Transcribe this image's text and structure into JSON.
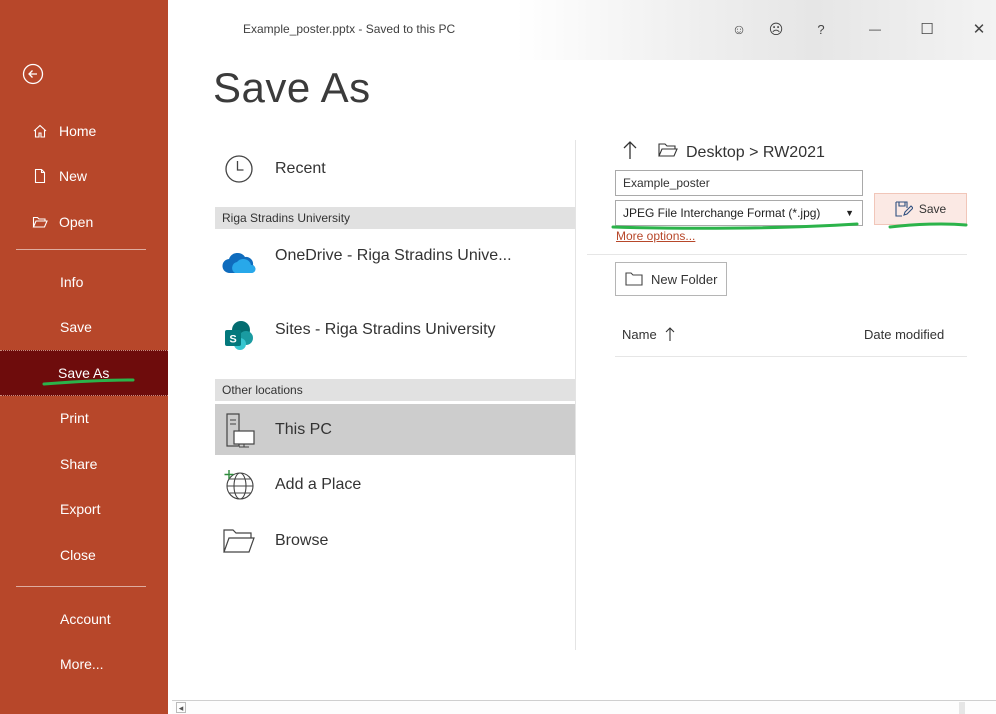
{
  "window": {
    "title": "Example_poster.pptx  -  Saved to this PC",
    "controls": {
      "smile": "☺",
      "frown": "☹",
      "help": "?",
      "minimize": "—",
      "maximize": "☐",
      "close": "✕"
    }
  },
  "page_title": "Save As",
  "sidebar": {
    "top": [
      {
        "label": "Home",
        "icon": "home-icon"
      },
      {
        "label": "New",
        "icon": "new-document-icon"
      },
      {
        "label": "Open",
        "icon": "open-folder-icon"
      }
    ],
    "middle": [
      "Info",
      "Save",
      "Save As",
      "Print",
      "Share",
      "Export",
      "Close"
    ],
    "active": "Save As",
    "bottom": [
      "Account",
      "More..."
    ]
  },
  "locations": {
    "recent": "Recent",
    "group1_header": "Riga Stradins University",
    "onedrive": "OneDrive - Riga Stradins Unive...",
    "sites": "Sites - Riga Stradins University",
    "group2_header": "Other locations",
    "this_pc": "This PC",
    "add_place": "Add a Place",
    "browse": "Browse"
  },
  "save_panel": {
    "path": "Desktop > RW2021",
    "filename": "Example_poster",
    "filetype": "JPEG File Interchange Format (*.jpg)",
    "more_options": "More options...",
    "save_label": "Save",
    "new_folder_label": "New Folder",
    "col_name": "Name",
    "col_date": "Date modified"
  },
  "colors": {
    "sidebar": "#b7472a",
    "sidebar_active": "#6e0c0c",
    "annotation": "#2bb34a",
    "link": "#b7472a"
  }
}
